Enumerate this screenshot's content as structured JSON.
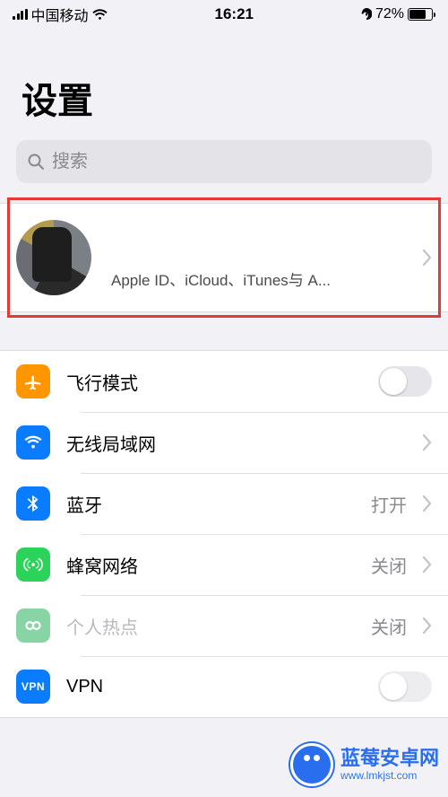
{
  "status": {
    "carrier": "中国移动",
    "time": "16:21",
    "battery_pct": "72%"
  },
  "header": {
    "title": "设置"
  },
  "search": {
    "placeholder": "搜索"
  },
  "apple_id": {
    "subtitle": "Apple ID、iCloud、iTunes与 A..."
  },
  "rows": {
    "airplane": {
      "label": "飞行模式",
      "on": false
    },
    "wifi": {
      "label": "无线局域网",
      "value": ""
    },
    "bluetooth": {
      "label": "蓝牙",
      "value": "打开"
    },
    "cellular": {
      "label": "蜂窝网络",
      "value": "关闭"
    },
    "hotspot": {
      "label": "个人热点",
      "value": "关闭"
    },
    "vpn": {
      "label": "VPN",
      "on": false,
      "tile_text": "VPN"
    }
  },
  "watermark": {
    "line1": "蓝莓安卓网",
    "line2": "www.lmkjst.com"
  }
}
